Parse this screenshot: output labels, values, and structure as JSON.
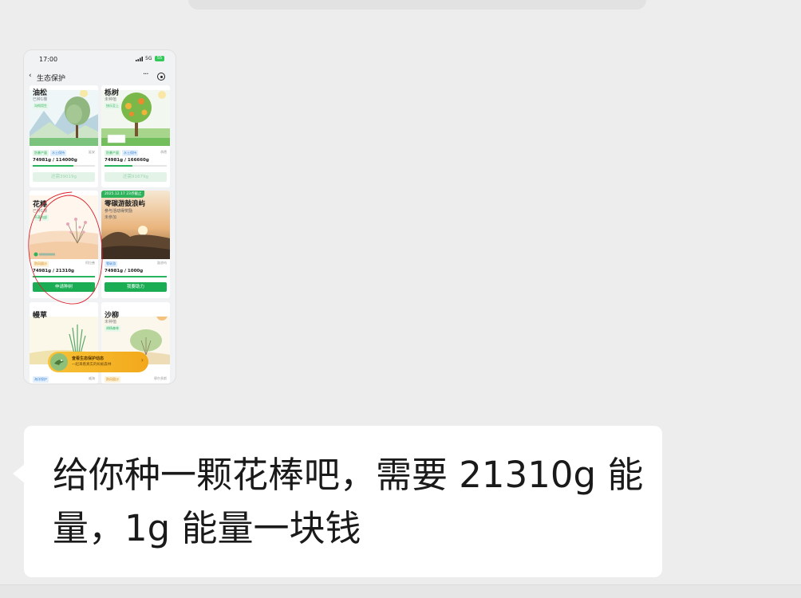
{
  "phone": {
    "time": "17:00",
    "network": "5G",
    "battery": "55",
    "nav_title": "生态保护",
    "more": "···"
  },
  "cards": [
    {
      "name": "油松",
      "sub": "已种1棵",
      "tag": "沟彻用生",
      "chips": [
        "防暴产量",
        "水土保持"
      ],
      "loc": "延安",
      "energy": "74981g / 114000g",
      "progress": 0.66,
      "button": "还需39019g"
    },
    {
      "name": "栎树",
      "sub": "未种植",
      "tag": "快乐至上",
      "chips": [
        "防暴产量",
        "水土保持"
      ],
      "loc": "承德",
      "energy": "74981g / 166660g",
      "progress": 0.45,
      "button": "还需91679g"
    },
    {
      "name": "花棒",
      "sub": "已种1棵",
      "tag": "不蒸内部",
      "chips": [
        "防风固沙"
      ],
      "loc": "阿拉善",
      "energy": "74981g / 21310g",
      "progress": 1.0,
      "button": "申请种树"
    },
    {
      "name": "零碳游鼓浪屿",
      "sub": "参与活动得奖励",
      "tag": "未参加",
      "date": "2025.12.17 23点截止",
      "chips": [
        "零碳游"
      ],
      "loc": "鼓浪屿",
      "energy": "74981g / 1000g",
      "progress": 1.0,
      "button": "我要助力"
    },
    {
      "name": "幔草",
      "sub": "",
      "tag": "",
      "chips": [
        "海洋保护"
      ],
      "loc": "威海",
      "energy": "",
      "progress": 0,
      "button": ""
    },
    {
      "name": "沙柳",
      "sub": "未种植",
      "tag": "胡杨森林",
      "chips": [
        "防风固沙"
      ],
      "loc": "鄂尔多斯",
      "energy": "",
      "progress": 0,
      "button": ""
    }
  ],
  "banner": {
    "title": "查看生态保护动态",
    "subtitle": "一起来看真实的蚂蚁森林"
  },
  "message": {
    "text": "给你种一颗花棒吧，需要 21310g 能量，1g 能量一块钱"
  },
  "colors": {
    "accent_green": "#1aad54",
    "annotation_red": "#d9232e",
    "bubble_bg": "#ffffff",
    "chat_bg": "#ededed"
  }
}
